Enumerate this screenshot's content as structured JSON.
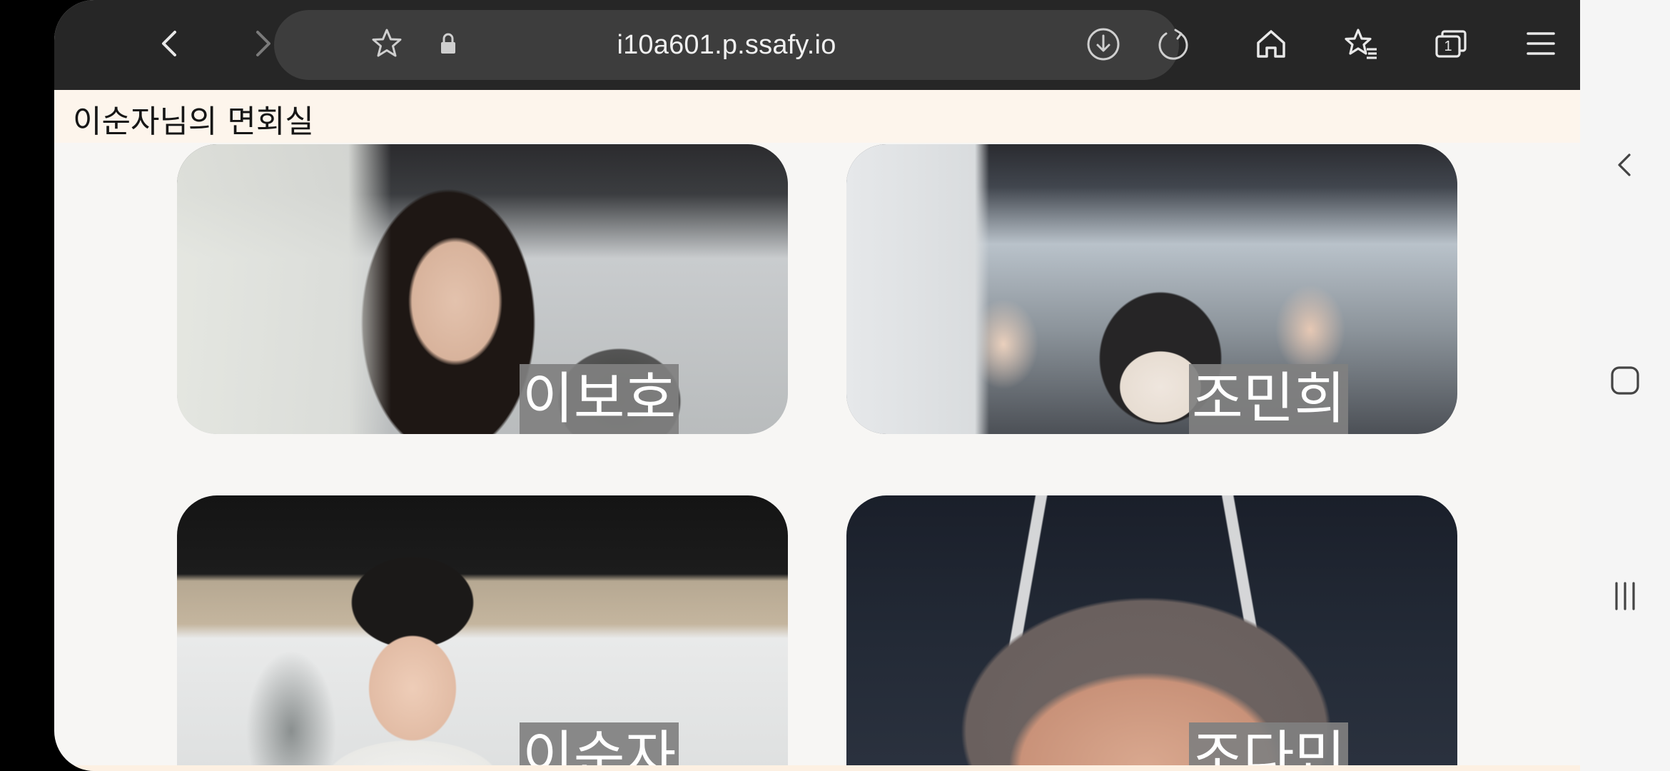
{
  "browser": {
    "url": "i10a601.p.ssafy.io",
    "tab_count": "1",
    "icons": {
      "back": "chevron-left-icon",
      "forward": "chevron-right-icon",
      "bookmark": "star-icon",
      "secure": "lock-icon",
      "download": "download-icon",
      "reload": "reload-icon",
      "home": "home-icon",
      "bookmarks": "star-list-icon",
      "tabs": "tabs-icon",
      "menu": "hamburger-menu-icon"
    }
  },
  "page": {
    "title": "이순자님의 면회실"
  },
  "participants": [
    {
      "name": "이보호"
    },
    {
      "name": "조민희"
    },
    {
      "name": "이순자"
    },
    {
      "name": "조다민"
    }
  ],
  "system_nav": {
    "icons": [
      "back-icon",
      "home-icon",
      "recents-icon"
    ]
  },
  "colors": {
    "browser_bar": "#262626",
    "url_pill": "#3d3d3d",
    "page_header": "#fdf5ec",
    "name_badge": "#808080"
  }
}
